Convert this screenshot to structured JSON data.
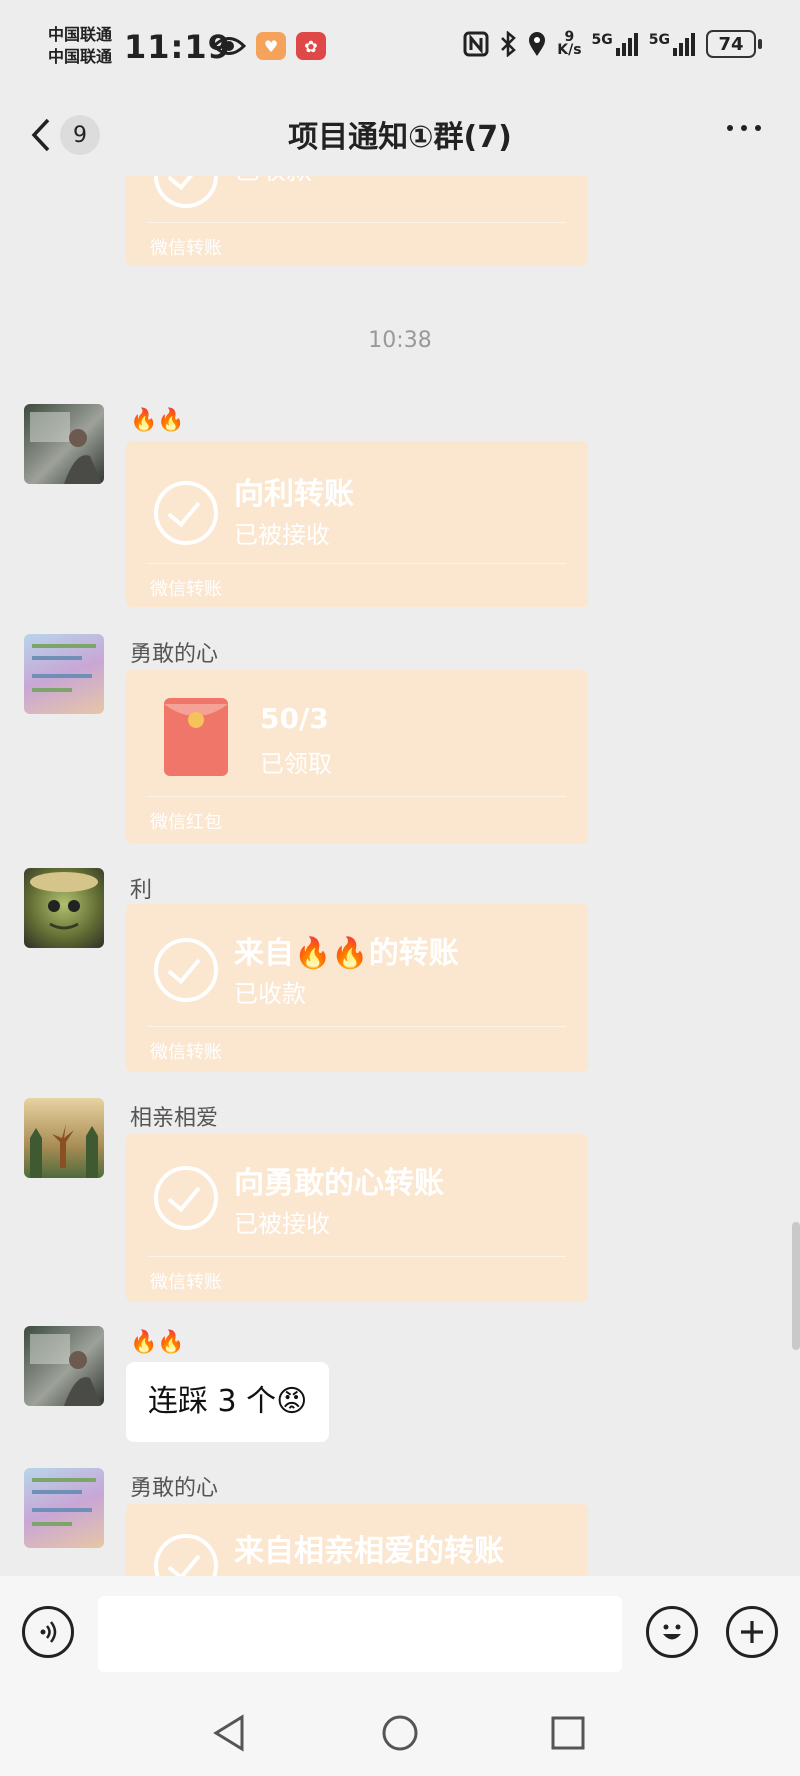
{
  "status": {
    "carrier1": "中国联通",
    "carrier2": "中国联通",
    "time": "11:19",
    "net_speed": "9",
    "net_unit": "K/s",
    "signal1": "5G",
    "signal2": "5G",
    "battery": "74"
  },
  "header": {
    "unread_badge": "9",
    "title": "项目通知①群(7)"
  },
  "chat": {
    "top_card": {
      "sub": "已收款",
      "footer": "微信转账"
    },
    "timestamp": "10:38",
    "messages": [
      {
        "sender": "🔥🔥",
        "main": "向利转账",
        "sub": "已被接收",
        "footer": "微信转账"
      },
      {
        "sender": "勇敢的心",
        "main": "50/3",
        "sub": "已领取",
        "footer": "微信红包"
      },
      {
        "sender": "利",
        "main": "来自🔥🔥的转账",
        "sub": "已收款",
        "footer": "微信转账"
      },
      {
        "sender": "相亲相爱",
        "main": "向勇敢的心转账",
        "sub": "已被接收",
        "footer": "微信转账"
      },
      {
        "sender": "🔥🔥",
        "text": "连踩 3 个😡"
      },
      {
        "sender": "勇敢的心",
        "main": "来自相亲相爱的转账"
      }
    ]
  },
  "colors": {
    "card_bg": "#fbe6cf",
    "chat_bg": "#ededed",
    "redpacket": "#f0766a"
  },
  "icons": [
    "back-chevron-icon",
    "more-icon",
    "voice-icon",
    "emoji-icon",
    "plus-icon",
    "check-icon",
    "red-packet-icon",
    "nav-back-icon",
    "nav-home-icon",
    "nav-recents-icon"
  ]
}
